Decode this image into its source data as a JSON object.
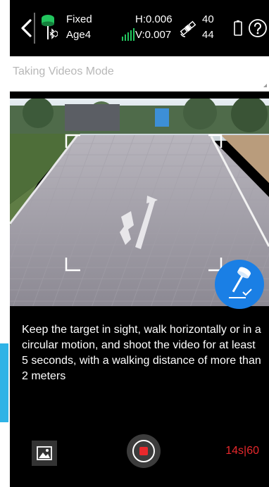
{
  "status": {
    "fix_status": "Fixed",
    "age": "Age4",
    "h_precision": "H:0.006",
    "v_precision": "V:0.007",
    "satellites_tracked": "40",
    "satellites_visible": "44",
    "icons": [
      "back-icon",
      "gnss-receiver-icon",
      "bluetooth-icon",
      "signal-bars-icon",
      "satellite-icon",
      "battery-icon",
      "help-icon"
    ]
  },
  "mode": {
    "placeholder": "Taking Videos Mode"
  },
  "instruction": {
    "text": "Keep the target in sight, walk horizontally or in a circular motion, and shoot the video for at least 5 seconds, with a walking distance of more than 2 meters"
  },
  "controls": {
    "timer": "14s|60",
    "icons": [
      "gallery-icon",
      "record-stop-icon",
      "rtk-pole-icon"
    ]
  },
  "colors": {
    "background": "#000000",
    "accent_blue": "#1a7fe5",
    "record_red": "#e8282c",
    "gnss_green": "#22c55e",
    "side_tab_cyan": "#2eb3e6"
  }
}
